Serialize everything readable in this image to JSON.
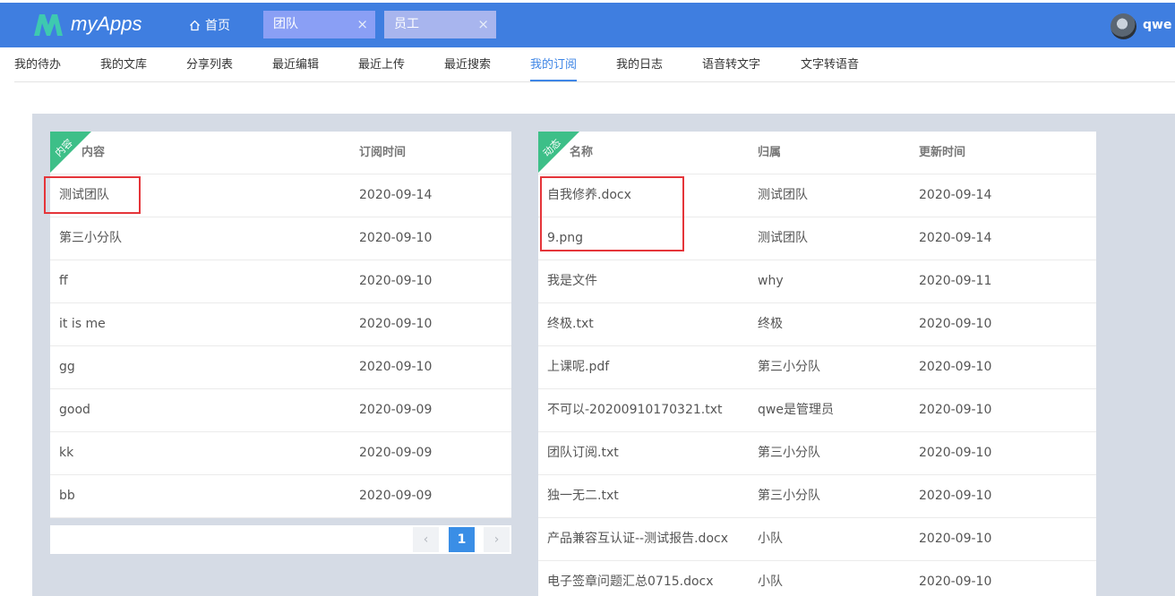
{
  "app": {
    "name": "myApps",
    "username": "qwe"
  },
  "top_tabs": {
    "home": "首页",
    "tabs": [
      {
        "label": "团队"
      },
      {
        "label": "员工"
      }
    ],
    "close_glyph": "×"
  },
  "subnav": [
    "我的待办",
    "我的文库",
    "分享列表",
    "最近编辑",
    "最近上传",
    "最近搜索",
    "我的订阅",
    "我的日志",
    "语音转文字",
    "文字转语音"
  ],
  "subnav_active": "我的订阅",
  "left_panel": {
    "badge": "内容",
    "headers": {
      "content": "内容",
      "time": "订阅时间"
    },
    "rows": [
      {
        "name": "测试团队",
        "time": "2020-09-14"
      },
      {
        "name": "第三小分队",
        "time": "2020-09-10"
      },
      {
        "name": "ff",
        "time": "2020-09-10"
      },
      {
        "name": "it is me",
        "time": "2020-09-10"
      },
      {
        "name": "gg",
        "time": "2020-09-10"
      },
      {
        "name": "good",
        "time": "2020-09-09"
      },
      {
        "name": "kk",
        "time": "2020-09-09"
      },
      {
        "name": "bb",
        "time": "2020-09-09"
      }
    ],
    "pager": {
      "prev": "‹",
      "current": "1",
      "next": "›"
    }
  },
  "right_panel": {
    "badge": "动态",
    "headers": {
      "name": "名称",
      "owner": "归属",
      "updated": "更新时间"
    },
    "rows": [
      {
        "name": "自我修养.docx",
        "owner": "测试团队",
        "updated": "2020-09-14"
      },
      {
        "name": "9.png",
        "owner": "测试团队",
        "updated": "2020-09-14"
      },
      {
        "name": "我是文件",
        "owner": "why",
        "updated": "2020-09-11"
      },
      {
        "name": "终极.txt",
        "owner": "终极",
        "updated": "2020-09-10"
      },
      {
        "name": "上课呢.pdf",
        "owner": "第三小分队",
        "updated": "2020-09-10"
      },
      {
        "name": "不可以-20200910170321.txt",
        "owner": "qwe是管理员",
        "updated": "2020-09-10"
      },
      {
        "name": "团队订阅.txt",
        "owner": "第三小分队",
        "updated": "2020-09-10"
      },
      {
        "name": "独一无二.txt",
        "owner": "第三小分队",
        "updated": "2020-09-10"
      },
      {
        "name": "产品兼容互认证--测试报告.docx",
        "owner": "小队",
        "updated": "2020-09-10"
      },
      {
        "name": "电子签章问题汇总0715.docx",
        "owner": "小队",
        "updated": "2020-09-10"
      }
    ]
  },
  "colors": {
    "topbar": "#3f7ee0",
    "accent": "#3a8ee6",
    "badge": "#3dbf88",
    "highlight_box": "#e5353a",
    "content_bg": "#d5dbe5"
  }
}
